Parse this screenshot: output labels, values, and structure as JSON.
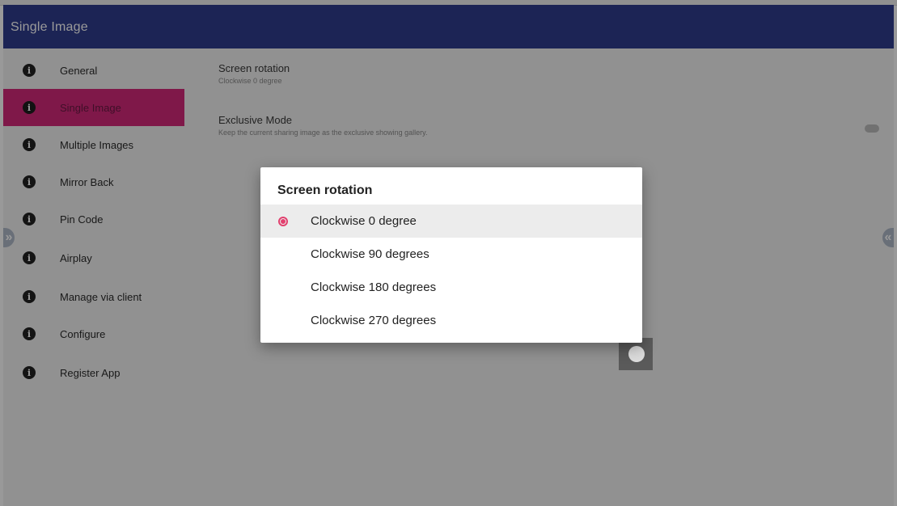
{
  "app": {
    "title": "Single Image"
  },
  "sidebar": {
    "items": [
      {
        "label": "General"
      },
      {
        "label": "Single Image"
      },
      {
        "label": "Multiple Images"
      },
      {
        "label": "Mirror Back"
      },
      {
        "label": "Pin Code"
      },
      {
        "label": "Airplay"
      },
      {
        "label": "Manage via client"
      },
      {
        "label": "Configure"
      },
      {
        "label": "Register App"
      }
    ],
    "icon": "info-icon",
    "active_index": 1
  },
  "content": {
    "screen_rotation": {
      "title": "Screen rotation",
      "subtitle": "Clockwise 0 degree"
    },
    "exclusive_mode": {
      "title": "Exclusive Mode",
      "subtitle": "Keep the current sharing image as the exclusive showing gallery."
    }
  },
  "edges": {
    "left_glyph": "»",
    "right_glyph": "«"
  },
  "dialog": {
    "title": "Screen rotation",
    "options": [
      {
        "label": "Clockwise 0 degree",
        "selected": true
      },
      {
        "label": "Clockwise 90 degrees",
        "selected": false
      },
      {
        "label": "Clockwise 180 degrees",
        "selected": false
      },
      {
        "label": "Clockwise 270 degrees",
        "selected": false
      }
    ]
  },
  "colors": {
    "appbar": "#2f3c8e",
    "accent": "#d4287a",
    "radio": "#e2406e"
  }
}
